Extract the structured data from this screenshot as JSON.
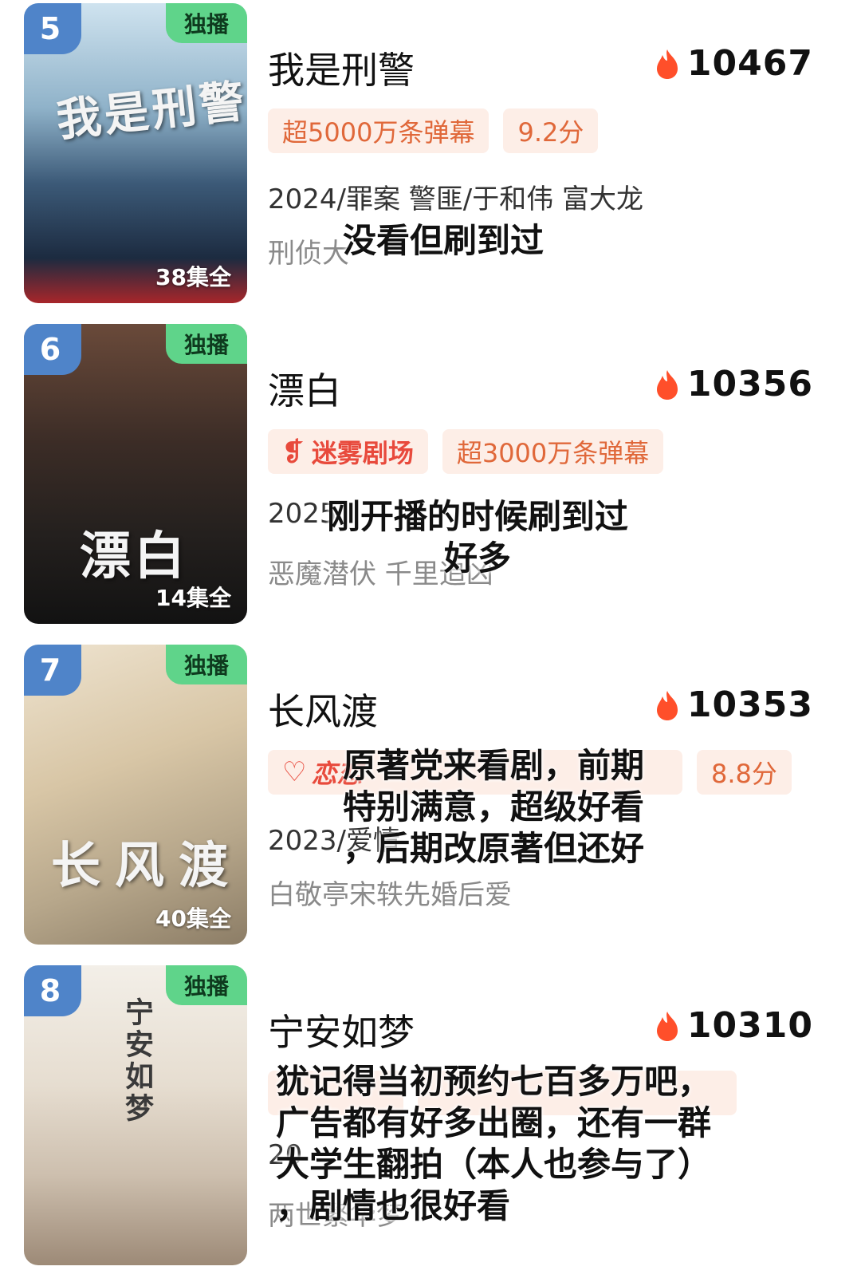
{
  "common": {
    "exclusive_label": "独播",
    "accent": "#e0683a",
    "flame_color": "#ff4f2a"
  },
  "items": [
    {
      "rank": "5",
      "rank_color": "#4f84c9",
      "title": "我是刑警",
      "heat": "10467",
      "poster_title": "我是刑警",
      "episodes": "38集全",
      "tags": [
        "超5000万条弹幕",
        "9.2分"
      ],
      "meta": "2024/罪案 警匪/于和伟 富大龙",
      "desc": "刑侦大",
      "overlay": "没看但刷到过"
    },
    {
      "rank": "6",
      "rank_color": "#4f84c9",
      "title": "漂白",
      "heat": "10356",
      "poster_title": "漂白",
      "episodes": "14集全",
      "tags": [
        "迷雾剧场",
        "超3000万条弹幕"
      ],
      "meta": "2025",
      "desc": "恶魔潜伏 千里追凶",
      "overlay": "刚开播的时候刷到过\n好多"
    },
    {
      "rank": "7",
      "rank_color": "#4f84c9",
      "title": "长风渡",
      "heat": "10353",
      "poster_title": "长风渡",
      "episodes": "40集全",
      "tags": [
        "恋恋",
        "8.8分"
      ],
      "meta": "2023/爱情",
      "desc": "白敬亭宋轶先婚后爱",
      "overlay": "原著党来看剧，前期\n特别满意，超级好看\n，后期改原著但还好"
    },
    {
      "rank": "8",
      "rank_color": "#4f84c9",
      "title": "宁安如梦",
      "heat": "10310",
      "poster_title": "宁安如梦",
      "episodes": "",
      "tags": [
        "",
        ""
      ],
      "meta": "20",
      "desc": "两世繁华梦",
      "overlay": "犹记得当初预约七百多万吧，\n广告都有好多出圈，还有一群\n大学生翻拍（本人也参与了）\n，剧情也很好看"
    }
  ]
}
